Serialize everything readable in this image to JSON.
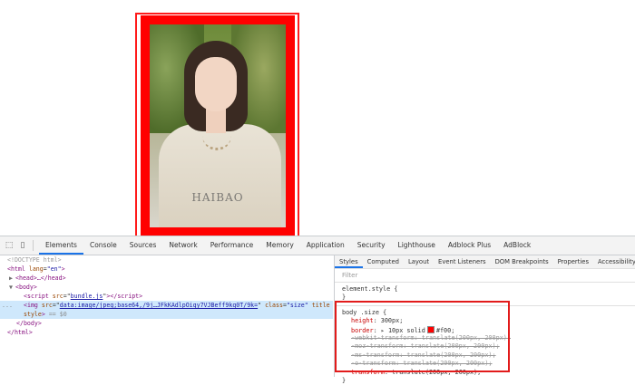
{
  "page": {
    "watermark": "HAIBAO"
  },
  "devtools": {
    "tabs": [
      "Elements",
      "Console",
      "Sources",
      "Network",
      "Performance",
      "Memory",
      "Application",
      "Security",
      "Lighthouse",
      "Adblock Plus",
      "AdBlock"
    ],
    "active_tab": "Elements",
    "dom": {
      "doctype": "<!DOCTYPE html>",
      "html_open_tag": "html",
      "html_attr_name": "lang",
      "html_attr_value": "\"en\"",
      "head_line": "<head>…</head>",
      "body_open": "<body>",
      "script_tag": "script",
      "script_attr": "src",
      "script_src": "bundle.js",
      "img_tag": "img",
      "img_src_attr": "src",
      "img_src": "data:image/jpeg;base64,/9j…JFkKAdlpOiqy7VJBeff9kq0T/9k=",
      "img_class_attr": "class",
      "img_class": "\"size\"",
      "img_title_attr": "title",
      "img_style_attr": "style",
      "img_eq": "== $0",
      "body_close": "</body>",
      "html_close": "</html>",
      "gutter": "..."
    },
    "styles": {
      "subtabs": [
        "Styles",
        "Computed",
        "Layout",
        "Event Listeners",
        "DOM Breakpoints",
        "Properties",
        "Accessibility"
      ],
      "active_subtab": "Styles",
      "filter_placeholder": "Filter",
      "element_style_open": "element.style {",
      "element_style_close": "}",
      "selector": "body .size {",
      "declarations": [
        {
          "prop": "height",
          "value": "300px;",
          "struck": false
        },
        {
          "prop": "border",
          "value": "10px solid",
          "color_value": "#f00;",
          "struck": false
        },
        {
          "prop": "-webkit-transform",
          "value": "translate(200px, 200px);",
          "struck": true
        },
        {
          "prop": "-moz-transform",
          "value": "translate(200px, 200px);",
          "struck": true
        },
        {
          "prop": "-ms-transform",
          "value": "translate(200px, 200px);",
          "struck": true
        },
        {
          "prop": "-o-transform",
          "value": "translate(200px, 200px);",
          "struck": true
        },
        {
          "prop": "transform",
          "value": "translate(200px, 200px);",
          "struck": false
        }
      ],
      "rule_close": "}"
    }
  },
  "colors": {
    "frame": "#ff0000",
    "highlight": "#ff1a1a",
    "accent": "#1a73e8"
  }
}
